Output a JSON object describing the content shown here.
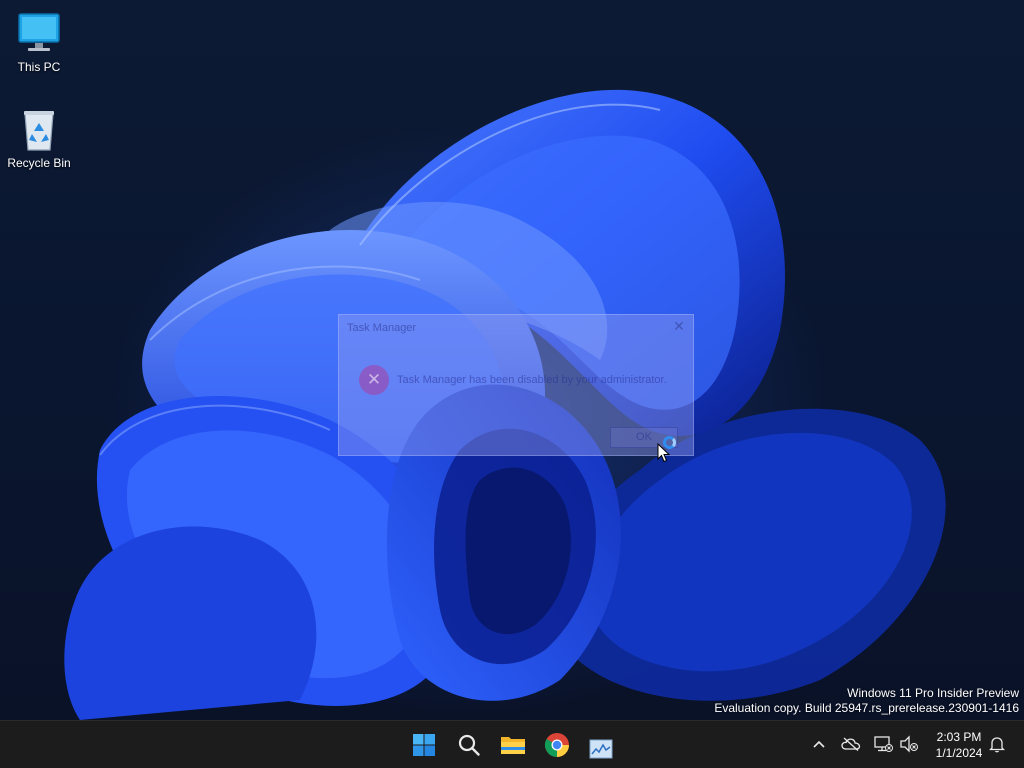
{
  "desktop": {
    "icons": [
      {
        "label": "This PC",
        "icon": "monitor-icon"
      },
      {
        "label": "Recycle Bin",
        "icon": "recycle-bin-icon"
      }
    ],
    "watermark": {
      "line1": "Windows 11 Pro Insider Preview",
      "line2": "Evaluation copy. Build 25947.rs_prerelease.230901-1416"
    }
  },
  "dialog": {
    "title": "Task Manager",
    "message": "Task Manager has been disabled by your administrator.",
    "ok_label": "OK",
    "close_glyph": "✕",
    "error_glyph": "✕"
  },
  "taskbar": {
    "apps": [
      {
        "name": "Start",
        "icon": "windows-start-icon"
      },
      {
        "name": "Search",
        "icon": "search-icon"
      },
      {
        "name": "File Explorer",
        "icon": "folder-icon"
      },
      {
        "name": "Google Chrome",
        "icon": "chrome-icon"
      },
      {
        "name": "Resource Monitor",
        "icon": "monitor-app-icon"
      }
    ],
    "tray": {
      "chevron": "^",
      "time": "2:03 PM",
      "date": "1/1/2024"
    }
  },
  "colors": {
    "accent": "#0078d4",
    "taskbar": "#1c1c1c",
    "wallpaper_blue": "#2a5cff"
  }
}
